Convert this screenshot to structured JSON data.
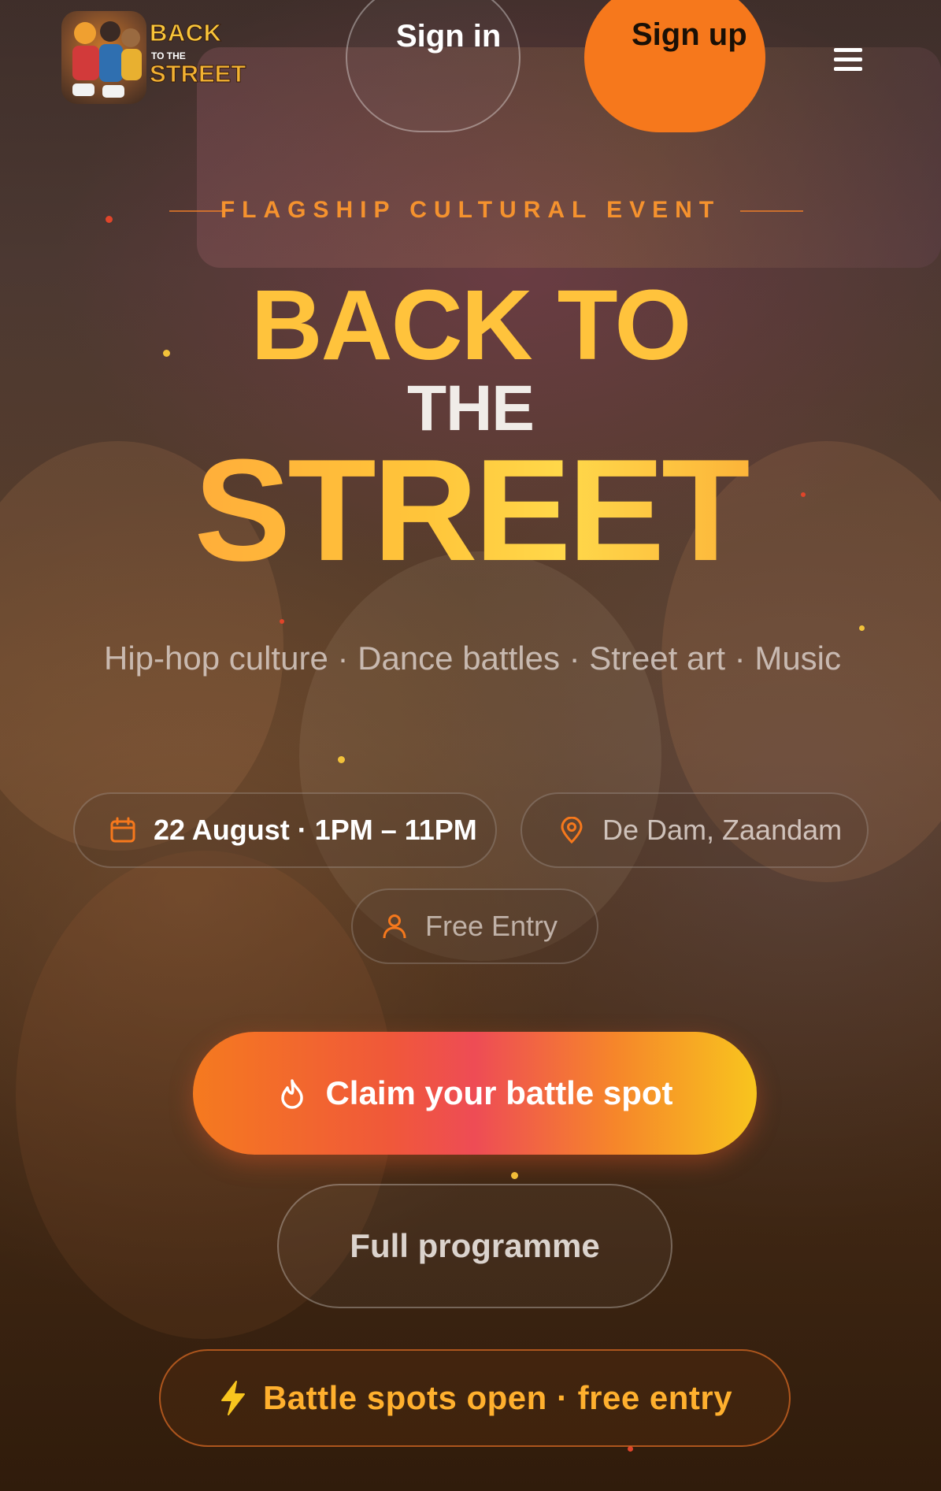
{
  "header": {
    "logo": {
      "line1": "BACK",
      "line2": "TO THE",
      "line3": "STREET"
    },
    "signin_label": "Sign in",
    "signup_label": "Sign up",
    "menu_icon": "hamburger-menu-icon"
  },
  "hero": {
    "eyebrow": "FLAGSHIP CULTURAL EVENT",
    "title_line1": "BACK TO",
    "title_line2": "THE",
    "title_line3": "STREET",
    "subtitle": "Hip-hop culture · Dance battles · Street art · Music"
  },
  "info": {
    "date": "22 August · 1PM – 11PM",
    "location": "De Dam, Zaandam",
    "entry": "Free Entry",
    "date_icon": "calendar-icon",
    "location_icon": "map-pin-icon",
    "entry_icon": "user-icon"
  },
  "cta": {
    "primary_label": "Claim your battle spot",
    "primary_icon": "flame-icon",
    "secondary_label": "Full programme",
    "badge_label": "Battle spots open · free entry",
    "badge_icon": "lightning-icon"
  },
  "colors": {
    "accent": "#f6781c",
    "title_gold": "#ffc33c",
    "badge_text": "#ffb02e"
  }
}
